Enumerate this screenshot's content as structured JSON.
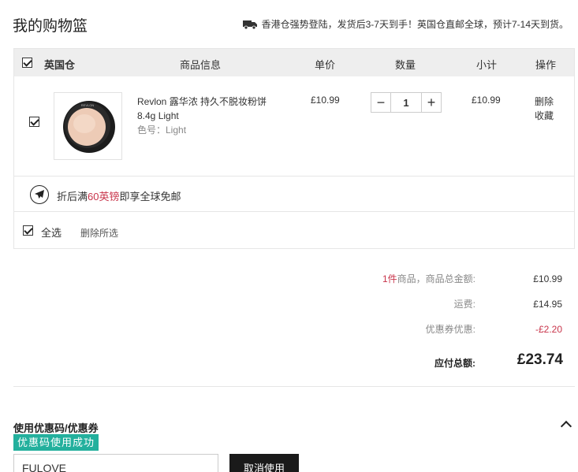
{
  "header": {
    "title": "我的购物篮",
    "shipping_note": "香港仓强势登陆，发货后3-7天到手！英国仓直邮全球，预计7-14天到货。",
    "truck_icon": "truck-icon"
  },
  "cart": {
    "columns": {
      "warehouse": "英国仓",
      "product_info": "商品信息",
      "unit_price": "单价",
      "quantity": "数量",
      "subtotal": "小计",
      "actions": "操作"
    },
    "items": [
      {
        "name": "Revlon 露华浓 持久不脱妆粉饼 8.4g Light",
        "spec": "色号：Light",
        "price": "£10.99",
        "quantity": "1",
        "subtotal": "£10.99",
        "delete": "删除",
        "favorite": "收藏",
        "checked": true
      }
    ],
    "promo": {
      "prefix": "折后满",
      "highlight": "60英镑",
      "suffix": "即享全球免邮",
      "icon": "airplane-icon"
    },
    "select_all": "全选",
    "delete_selected": "删除所选"
  },
  "summary": {
    "count": "1件",
    "count_label": "商品，商品总金额:",
    "goods_total": "£10.99",
    "shipping_label": "运费:",
    "shipping": "£14.95",
    "coupon_label": "优惠券优惠:",
    "coupon_discount": "-£2.20",
    "total_label": "应付总额:",
    "total": "£23.74"
  },
  "coupon": {
    "title": "使用优惠码/优惠券",
    "status": "优惠码使用成功",
    "code": "FULOVE",
    "cancel": "取消使用"
  },
  "colors": {
    "accent_red": "#c8344a",
    "success_teal": "#23b09d",
    "button_dark": "#1a1a1a",
    "header_bg": "#eeeeee"
  }
}
